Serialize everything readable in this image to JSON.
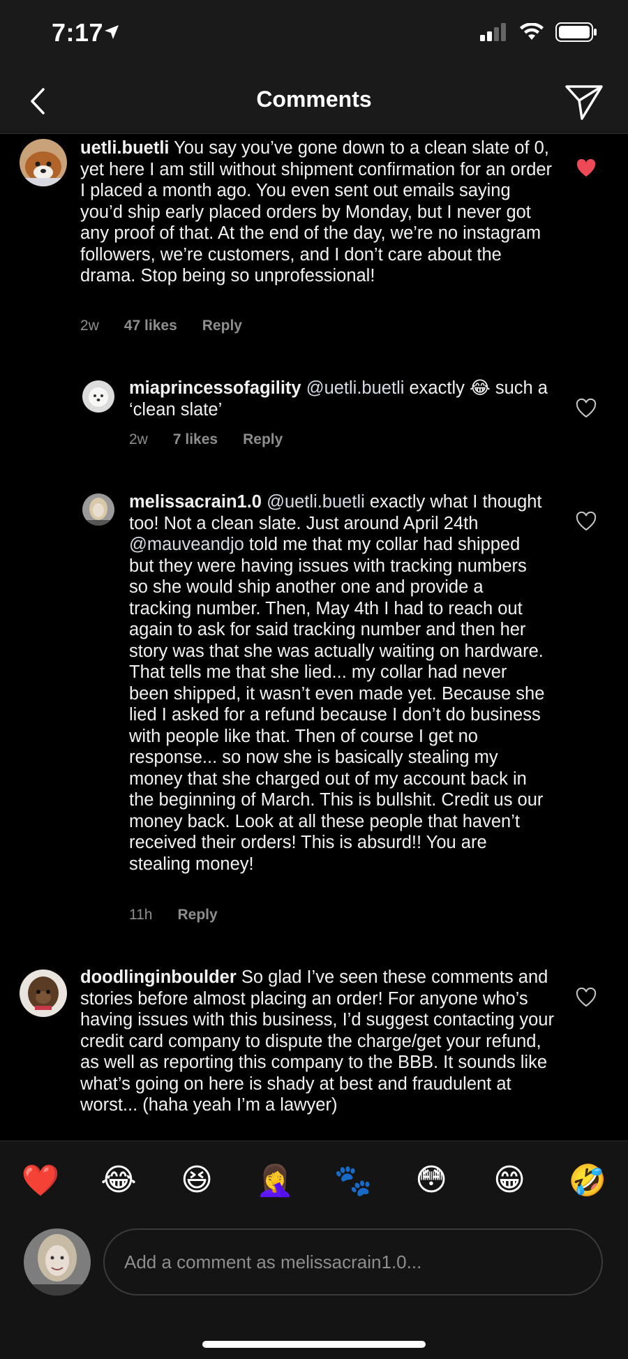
{
  "status_bar": {
    "time": "7:17",
    "icons": [
      "location-arrow-icon",
      "cellular-signal-icon",
      "wifi-icon",
      "battery-icon"
    ]
  },
  "nav": {
    "title": "Comments",
    "back_icon": "chevron-left-icon",
    "share_icon": "paper-plane-icon"
  },
  "comments": [
    {
      "username": "uetli.buetli",
      "text": "You say you’ve gone down to a clean slate of 0, yet here I am still without shipment confirmation for an order I placed a month ago. You even sent out emails saying you’d ship early placed orders by Monday, but I never got any proof of that. At the end of the day, we’re no instagram followers, we’re customers, and I don’t care about the drama. Stop being so unprofessional!",
      "time": "2w",
      "likes": "47 likes",
      "reply": "Reply",
      "liked": true
    },
    {
      "username": "miaprincessofagility",
      "mention": "@uetli.buetli",
      "text": "exactly 😂 such a ‘clean slate’",
      "time": "2w",
      "likes": "7 likes",
      "reply": "Reply",
      "liked": false
    },
    {
      "username": "melissacrain1.0",
      "mention": "@uetli.buetli",
      "text_a": "exactly what I thought too! Not a clean slate. Just around April 24th",
      "mention2": "@mauveandjo",
      "text_b": "told me that my collar had shipped but they were having issues with tracking numbers so she would ship another one and provide a tracking number. Then, May 4th I had to reach out again to ask for said tracking number and then her story was that she was actually waiting on hardware. That tells me that she lied... my collar had never been shipped, it wasn’t even made yet. Because she lied I asked for a refund because I don’t do business with people like that. Then of course I get no response... so now she is basically stealing my money that she charged out of my account back in the beginning of March. This is bullshit. Credit us our money back. Look at all these people that haven’t received their orders! This is absurd!! You are stealing money!",
      "time": "11h",
      "reply": "Reply",
      "liked": false
    },
    {
      "username": "doodlinginboulder",
      "text": "So glad I’ve seen these comments and stories before almost placing an order!  For anyone who’s having issues with this business, I’d suggest contacting your credit card company to dispute the charge/get your refund, as well as reporting this company to the BBB. It sounds like what’s going on here is shady at best and fraudulent at worst... (haha yeah I’m a lawyer)",
      "liked": false
    }
  ],
  "emoji_bar": [
    "❤️",
    "😂",
    "😆",
    "🤦‍♀️",
    "🐾",
    "😳",
    "😁",
    "🤣"
  ],
  "composer": {
    "placeholder": "Add a comment as melissacrain1.0..."
  },
  "colors": {
    "background": "#000000",
    "header": "#1a1a1a",
    "liked_heart": "#ed4956",
    "meta_text": "#8e8e8e"
  }
}
